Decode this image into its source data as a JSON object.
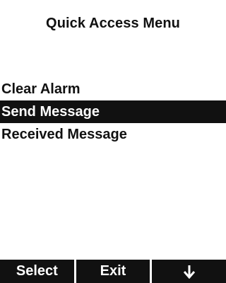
{
  "header": {
    "title": "Quick Access Menu"
  },
  "menu": {
    "items": [
      {
        "label": "Clear Alarm",
        "selected": false
      },
      {
        "label": "Send Message",
        "selected": true
      },
      {
        "label": "Received Message",
        "selected": false
      }
    ]
  },
  "softkeys": {
    "left_label": "Select",
    "middle_label": "Exit",
    "right_icon": "down-arrow-icon"
  },
  "colors": {
    "background": "#ffffff",
    "text": "#111111",
    "highlight": "#111111",
    "highlight_text": "#ffffff"
  }
}
